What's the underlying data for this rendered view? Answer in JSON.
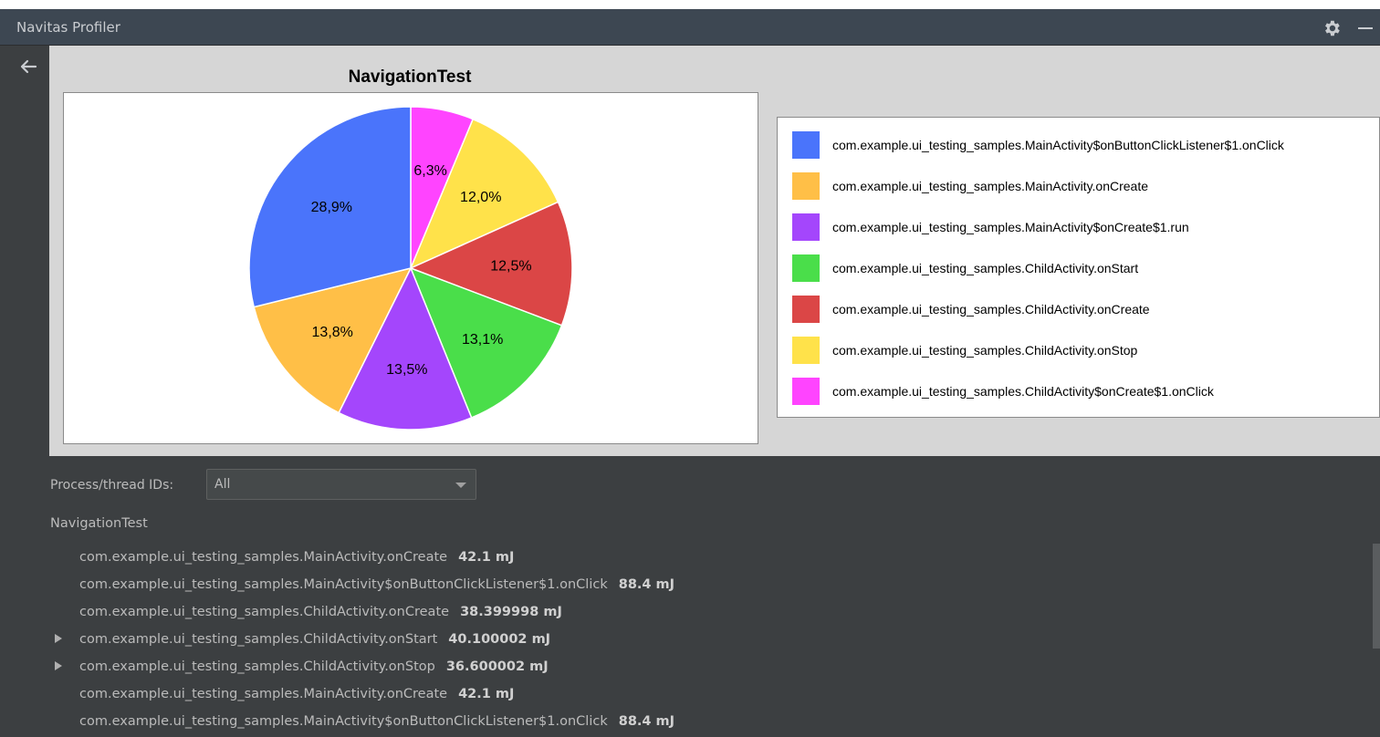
{
  "window": {
    "title": "Navitas Profiler",
    "settings_icon": "gear-icon",
    "minimize_icon": "minimize-icon"
  },
  "nav": {
    "back_icon": "arrow-left-icon"
  },
  "chart_data": {
    "type": "pie",
    "title": "NavigationTest",
    "slices": [
      {
        "label": "com.example.ui_testing_samples.ChildActivity$onCreate$1.onClick",
        "value": 6.3,
        "display": "6,3%",
        "color": "#ff44ff"
      },
      {
        "label": "com.example.ui_testing_samples.ChildActivity.onStop",
        "value": 12.0,
        "display": "12,0%",
        "color": "#ffe24a"
      },
      {
        "label": "com.example.ui_testing_samples.ChildActivity.onCreate",
        "value": 12.5,
        "display": "12,5%",
        "color": "#db4646"
      },
      {
        "label": "com.example.ui_testing_samples.ChildActivity.onStart",
        "value": 13.1,
        "display": "13,1%",
        "color": "#4ade4a"
      },
      {
        "label": "com.example.ui_testing_samples.MainActivity$onCreate$1.run",
        "value": 13.5,
        "display": "13,5%",
        "color": "#a446fc"
      },
      {
        "label": "com.example.ui_testing_samples.MainActivity.onCreate",
        "value": 13.8,
        "display": "13,8%",
        "color": "#ffbf47"
      },
      {
        "label": "com.example.ui_testing_samples.MainActivity$onButtonClickListener$1.onClick",
        "value": 28.9,
        "display": "28,9%",
        "color": "#4a74fb"
      }
    ],
    "legend_placement": "right",
    "legend": [
      {
        "label": "com.example.ui_testing_samples.MainActivity$onButtonClickListener$1.onClick",
        "color": "#4a74fb"
      },
      {
        "label": "com.example.ui_testing_samples.MainActivity.onCreate",
        "color": "#ffbf47"
      },
      {
        "label": "com.example.ui_testing_samples.MainActivity$onCreate$1.run",
        "color": "#a446fc"
      },
      {
        "label": "com.example.ui_testing_samples.ChildActivity.onStart",
        "color": "#4ade4a"
      },
      {
        "label": "com.example.ui_testing_samples.ChildActivity.onCreate",
        "color": "#db4646"
      },
      {
        "label": "com.example.ui_testing_samples.ChildActivity.onStop",
        "color": "#ffe24a"
      },
      {
        "label": "com.example.ui_testing_samples.ChildActivity$onCreate$1.onClick",
        "color": "#ff44ff"
      }
    ]
  },
  "filter": {
    "label": "Process/thread IDs:",
    "selected": "All"
  },
  "tree": {
    "root": "NavigationTest",
    "rows": [
      {
        "name": "com.example.ui_testing_samples.MainActivity.onCreate",
        "energy": "42.1 mJ",
        "expandable": false
      },
      {
        "name": "com.example.ui_testing_samples.MainActivity$onButtonClickListener$1.onClick",
        "energy": "88.4 mJ",
        "expandable": false
      },
      {
        "name": "com.example.ui_testing_samples.ChildActivity.onCreate",
        "energy": "38.399998 mJ",
        "expandable": false
      },
      {
        "name": "com.example.ui_testing_samples.ChildActivity.onStart",
        "energy": "40.100002 mJ",
        "expandable": true
      },
      {
        "name": "com.example.ui_testing_samples.ChildActivity.onStop",
        "energy": "36.600002 mJ",
        "expandable": true
      },
      {
        "name": "com.example.ui_testing_samples.MainActivity.onCreate",
        "energy": "42.1 mJ",
        "expandable": false
      },
      {
        "name": "com.example.ui_testing_samples.MainActivity$onButtonClickListener$1.onClick",
        "energy": "88.4 mJ",
        "expandable": false
      }
    ]
  }
}
